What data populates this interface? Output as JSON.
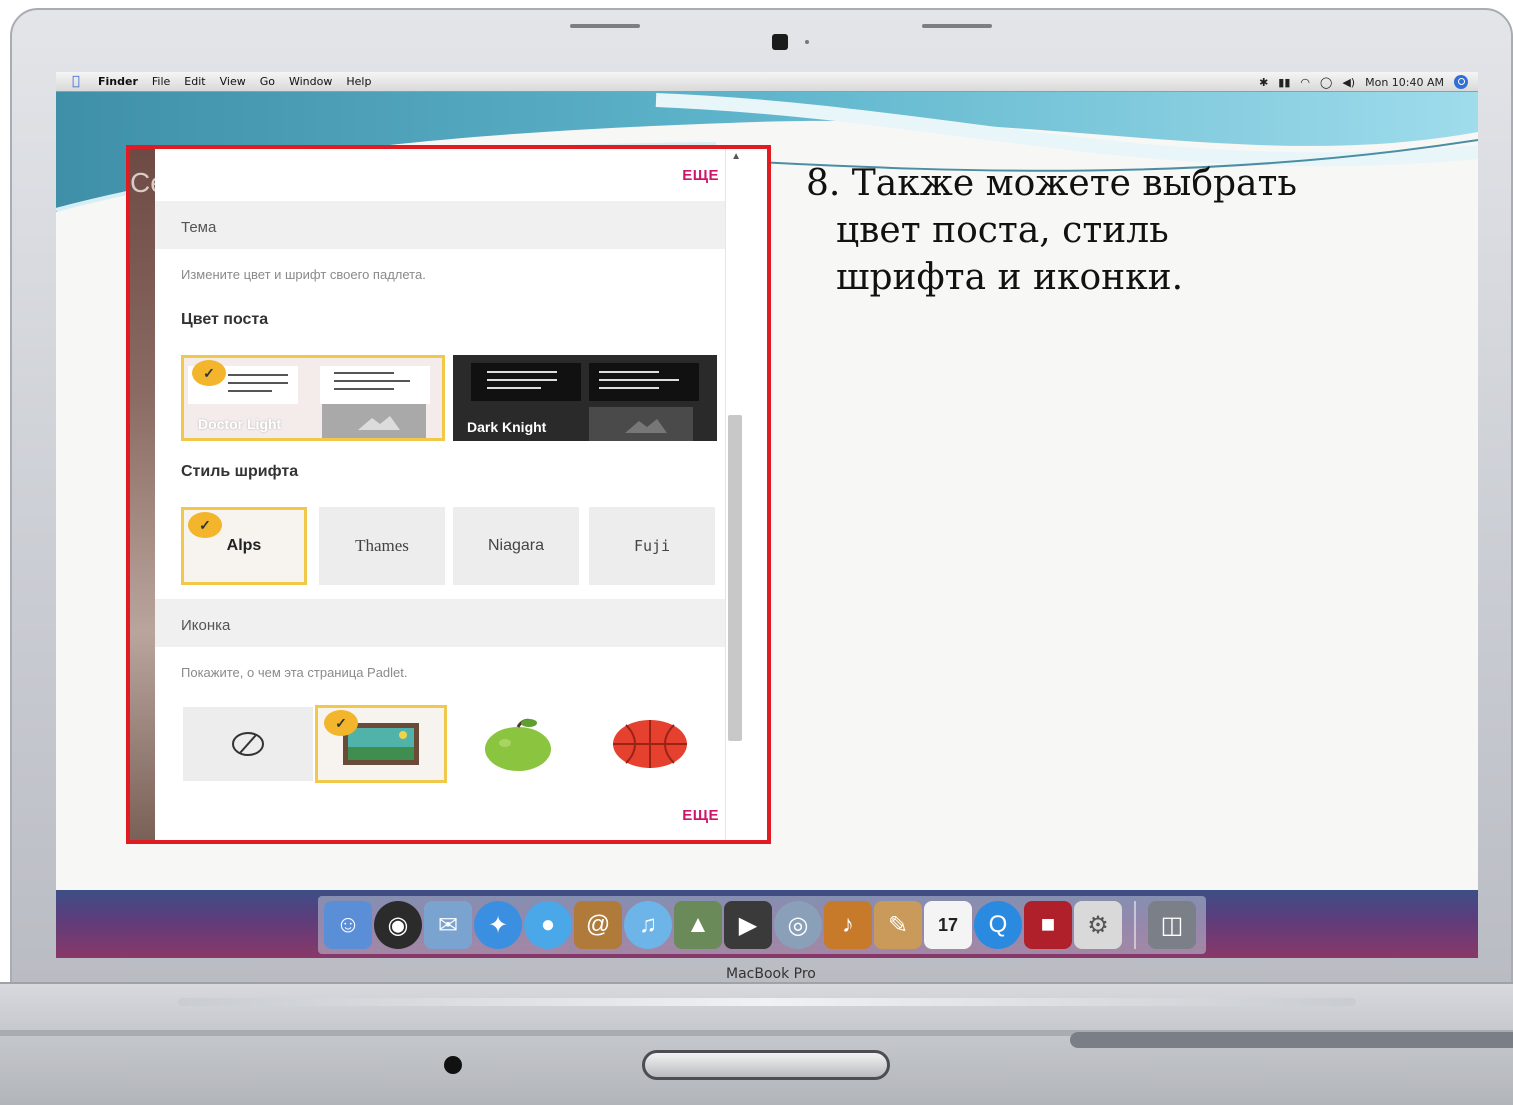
{
  "menubar": {
    "app_name": "Finder",
    "items": [
      "File",
      "Edit",
      "View",
      "Go",
      "Window",
      "Help"
    ],
    "clock": "Mon 10:40 AM"
  },
  "slide": {
    "instruction_line1": "8. Также можете выбрать",
    "instruction_line2": "цвет поста, стиль",
    "instruction_line3": "шрифта и иконки."
  },
  "panel": {
    "partial_title": "Се",
    "more_label": "ЕЩЕ",
    "theme_section": {
      "title": "Тема",
      "description": "Измените цвет и шрифт своего падлета.",
      "post_color_label": "Цвет поста",
      "post_colors": [
        {
          "name": "Doctor Light",
          "selected": true
        },
        {
          "name": "Dark Knight",
          "selected": false
        }
      ],
      "font_style_label": "Стиль шрифта",
      "fonts": [
        {
          "name": "Alps",
          "selected": true
        },
        {
          "name": "Thames",
          "selected": false
        },
        {
          "name": "Niagara",
          "selected": false
        },
        {
          "name": "Fuji",
          "selected": false
        }
      ]
    },
    "icon_section": {
      "title": "Иконка",
      "description": "Покажите, о чем эта страница Padlet.",
      "icons": [
        {
          "name": "none-icon",
          "selected": false
        },
        {
          "name": "picture-icon",
          "selected": true
        },
        {
          "name": "apple-icon",
          "selected": false
        },
        {
          "name": "basketball-icon",
          "selected": false
        }
      ],
      "more_label": "ЕЩЕ"
    }
  },
  "dock": {
    "apps": [
      "finder",
      "dashboard",
      "mail",
      "safari",
      "ichat",
      "address-book",
      "itunes",
      "iphoto",
      "imovie",
      "idvd",
      "garageband",
      "iweb",
      "ical",
      "quicktime",
      "front-row",
      "system-preferences",
      "trash"
    ]
  },
  "laptop": {
    "brand_label": "MacBook Pro"
  },
  "colors": {
    "frame_red": "#e01b22",
    "selected_border": "#f2c84b",
    "check_badge": "#f2b52c",
    "more_link": "#d0146a"
  }
}
